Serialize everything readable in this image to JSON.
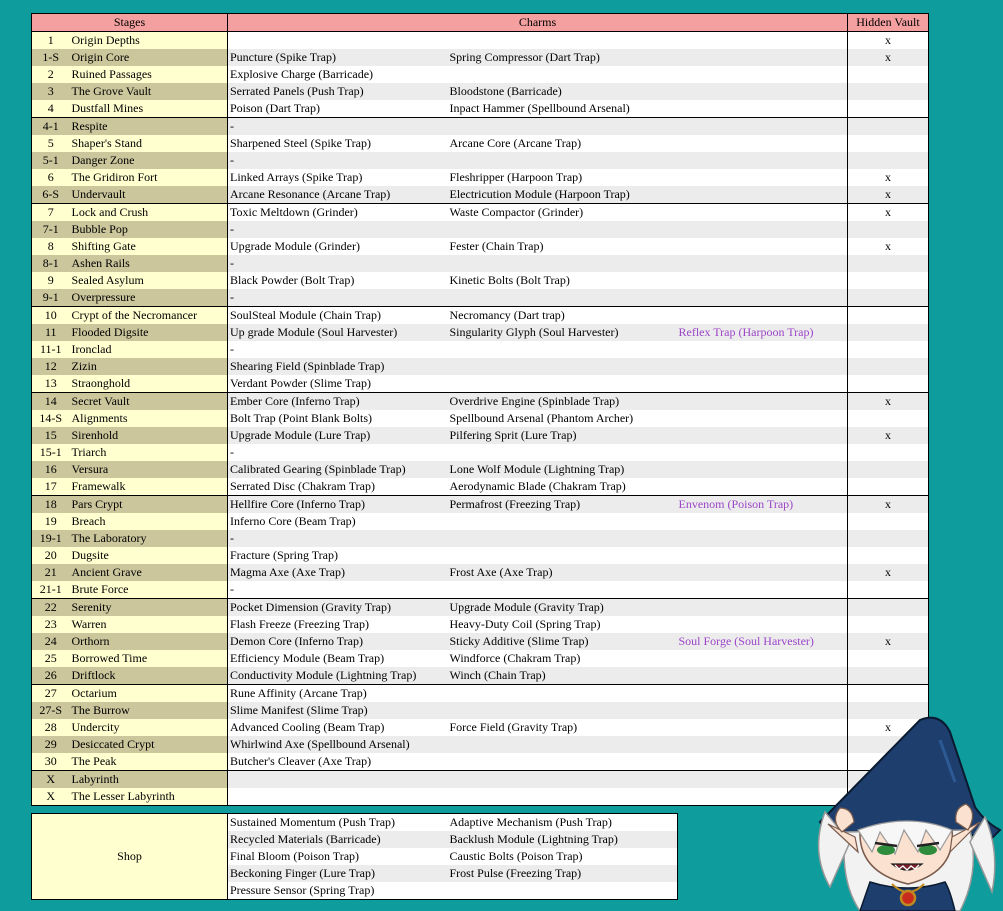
{
  "headers": {
    "stages": "Stages",
    "charms": "Charms",
    "vault": "Hidden Vault"
  },
  "rows": [
    {
      "num": "1",
      "name": "Origin Depths",
      "c1": "",
      "c2": "",
      "c3": "",
      "vault": "x"
    },
    {
      "num": "1-S",
      "name": "Origin Core",
      "c1": "Puncture (Spike Trap)",
      "c2": "Spring Compressor (Dart Trap)",
      "c3": "",
      "vault": "x"
    },
    {
      "num": "2",
      "name": "Ruined Passages",
      "c1": "Explosive Charge (Barricade)",
      "c2": "",
      "c3": "",
      "vault": ""
    },
    {
      "num": "3",
      "name": "The Grove Vault",
      "c1": "Serrated Panels (Push Trap)",
      "c2": "Bloodstone (Barricade)",
      "c3": "",
      "vault": ""
    },
    {
      "num": "4",
      "name": "Dustfall Mines",
      "c1": "Poison (Dart Trap)",
      "c2": "Inpact Hammer (Spellbound Arsenal)",
      "c3": "",
      "vault": ""
    },
    {
      "num": "4-1",
      "name": "Respite",
      "c1": "-",
      "c2": "",
      "c3": "",
      "vault": ""
    },
    {
      "num": "5",
      "name": "Shaper's Stand",
      "c1": "Sharpened Steel (Spike Trap)",
      "c2": "Arcane Core (Arcane Trap)",
      "c3": "",
      "vault": ""
    },
    {
      "num": "5-1",
      "name": "Danger Zone",
      "c1": "-",
      "c2": "",
      "c3": "",
      "vault": ""
    },
    {
      "num": "6",
      "name": "The Gridiron Fort",
      "c1": "Linked Arrays (Spike Trap)",
      "c2": "Fleshripper (Harpoon Trap)",
      "c3": "",
      "vault": "x"
    },
    {
      "num": "6-S",
      "name": "Undervault",
      "c1": "Arcane Resonance (Arcane Trap)",
      "c2": "Electricution Module (Harpoon Trap)",
      "c3": "",
      "vault": "x"
    },
    {
      "num": "7",
      "name": "Lock and Crush",
      "c1": "Toxic Meltdown (Grinder)",
      "c2": "Waste Compactor (Grinder)",
      "c3": "",
      "vault": "x"
    },
    {
      "num": "7-1",
      "name": "Bubble Pop",
      "c1": "-",
      "c2": "",
      "c3": "",
      "vault": ""
    },
    {
      "num": "8",
      "name": "Shifting Gate",
      "c1": "Upgrade Module (Grinder)",
      "c2": "Fester (Chain Trap)",
      "c3": "",
      "vault": "x"
    },
    {
      "num": "8-1",
      "name": "Ashen Rails",
      "c1": "-",
      "c2": "",
      "c3": "",
      "vault": ""
    },
    {
      "num": "9",
      "name": "Sealed Asylum",
      "c1": "Black Powder (Bolt Trap)",
      "c2": "Kinetic Bolts (Bolt Trap)",
      "c3": "",
      "vault": ""
    },
    {
      "num": "9-1",
      "name": "Overpressure",
      "c1": "-",
      "c2": "",
      "c3": "",
      "vault": ""
    },
    {
      "num": "10",
      "name": "Crypt of the Necromancer",
      "c1": "SoulSteal Module (Chain Trap)",
      "c2": "Necromancy (Dart trap)",
      "c3": "",
      "vault": ""
    },
    {
      "num": "11",
      "name": "Flooded Digsite",
      "c1": "Up grade Module (Soul Harvester)",
      "c2": "Singularity Glyph (Soul Harvester)",
      "c3": "Reflex Trap (Harpoon Trap)",
      "vault": ""
    },
    {
      "num": "11-1",
      "name": "Ironclad",
      "c1": "-",
      "c2": "",
      "c3": "",
      "vault": ""
    },
    {
      "num": "12",
      "name": "Zizin",
      "c1": "Shearing Field (Spinblade Trap)",
      "c2": "",
      "c3": "",
      "vault": ""
    },
    {
      "num": "13",
      "name": "Straonghold",
      "c1": "Verdant Powder (Slime Trap)",
      "c2": "",
      "c3": "",
      "vault": ""
    },
    {
      "num": "14",
      "name": "Secret Vault",
      "c1": "Ember Core (Inferno Trap)",
      "c2": "Overdrive Engine (Spinblade Trap)",
      "c3": "",
      "vault": "x"
    },
    {
      "num": "14-S",
      "name": "Alignments",
      "c1": "Bolt Trap (Point Blank Bolts)",
      "c2": "Spellbound Arsenal (Phantom Archer)",
      "c3": "",
      "vault": ""
    },
    {
      "num": "15",
      "name": "Sirenhold",
      "c1": "Upgrade Module (Lure Trap)",
      "c2": "Pilfering Sprit (Lure Trap)",
      "c3": "",
      "vault": "x"
    },
    {
      "num": "15-1",
      "name": "Triarch",
      "c1": "-",
      "c2": "",
      "c3": "",
      "vault": ""
    },
    {
      "num": "16",
      "name": "Versura",
      "c1": "Calibrated Gearing (Spinblade Trap)",
      "c2": "Lone Wolf Module (Lightning Trap)",
      "c3": "",
      "vault": ""
    },
    {
      "num": "17",
      "name": "Framewalk",
      "c1": "Serrated Disc (Chakram Trap)",
      "c2": "Aerodynamic Blade (Chakram Trap)",
      "c3": "",
      "vault": ""
    },
    {
      "num": "18",
      "name": "Pars Crypt",
      "c1": "Hellfire Core (Inferno Trap)",
      "c2": "Permafrost (Freezing Trap)",
      "c3": "Envenom (Poison Trap)",
      "vault": "x"
    },
    {
      "num": "19",
      "name": "Breach",
      "c1": "Inferno Core (Beam Trap)",
      "c2": "",
      "c3": "",
      "vault": ""
    },
    {
      "num": "19-1",
      "name": "The Laboratory",
      "c1": "-",
      "c2": "",
      "c3": "",
      "vault": ""
    },
    {
      "num": "20",
      "name": "Dugsite",
      "c1": "Fracture (Spring Trap)",
      "c2": "",
      "c3": "",
      "vault": ""
    },
    {
      "num": "21",
      "name": "Ancient Grave",
      "c1": "Magma Axe (Axe Trap)",
      "c2": "Frost Axe (Axe Trap)",
      "c3": "",
      "vault": "x"
    },
    {
      "num": "21-1",
      "name": "Brute Force",
      "c1": "-",
      "c2": "",
      "c3": "",
      "vault": ""
    },
    {
      "num": "22",
      "name": "Serenity",
      "c1": "Pocket Dimension (Gravity Trap)",
      "c2": "Upgrade Module (Gravity Trap)",
      "c3": "",
      "vault": ""
    },
    {
      "num": "23",
      "name": "Warren",
      "c1": "Flash Freeze (Freezing Trap)",
      "c2": "Heavy-Duty Coil (Spring Trap)",
      "c3": "",
      "vault": ""
    },
    {
      "num": "24",
      "name": "Orthorn",
      "c1": "Demon Core (Inferno Trap)",
      "c2": "Sticky Additive (Slime Trap)",
      "c3": "Soul Forge (Soul Harvester)",
      "vault": "x"
    },
    {
      "num": "25",
      "name": "Borrowed Time",
      "c1": "Efficiency Module (Beam Trap)",
      "c2": "Windforce (Chakram Trap)",
      "c3": "",
      "vault": ""
    },
    {
      "num": "26",
      "name": "Driftlock",
      "c1": "Conductivity Module (Lightning Trap)",
      "c2": "Winch (Chain Trap)",
      "c3": "",
      "vault": ""
    },
    {
      "num": "27",
      "name": "Octarium",
      "c1": "Rune Affinity (Arcane Trap)",
      "c2": "",
      "c3": "",
      "vault": ""
    },
    {
      "num": "27-S",
      "name": "The Burrow",
      "c1": "Slime Manifest (Slime Trap)",
      "c2": "",
      "c3": "",
      "vault": ""
    },
    {
      "num": "28",
      "name": "Undercity",
      "c1": "Advanced Cooling (Beam Trap)",
      "c2": "Force Field (Gravity Trap)",
      "c3": "",
      "vault": "x"
    },
    {
      "num": "29",
      "name": "Desiccated Crypt",
      "c1": "Whirlwind Axe (Spellbound Arsenal)",
      "c2": "",
      "c3": "",
      "vault": ""
    },
    {
      "num": "30",
      "name": "The Peak",
      "c1": "Butcher's Cleaver (Axe Trap)",
      "c2": "",
      "c3": "",
      "vault": ""
    },
    {
      "num": "X",
      "name": "Labyrinth",
      "c1": "",
      "c2": "",
      "c3": "",
      "vault": ""
    },
    {
      "num": "X",
      "name": "The Lesser Labyrinth",
      "c1": "",
      "c2": "",
      "c3": "",
      "vault": ""
    }
  ],
  "shop": {
    "label": "Shop",
    "rows": [
      {
        "c1": "Sustained Momentum (Push Trap)",
        "c2": "Adaptive Mechanism (Push Trap)"
      },
      {
        "c1": "Recycled Materials (Barricade)",
        "c2": "Backlush Module (Lightning Trap)"
      },
      {
        "c1": "Final Bloom (Poison Trap)",
        "c2": "Caustic Bolts (Poison Trap)"
      },
      {
        "c1": "Beckoning Finger (Lure Trap)",
        "c2": "Frost Pulse (Freezing Trap)"
      },
      {
        "c1": "Pressure Sensor (Spring Trap)",
        "c2": ""
      }
    ]
  },
  "colors": {
    "background": "#0f9c9c",
    "header": "#f4a0a0",
    "stage_light": "#ffffd0",
    "stage_dark": "#cbc69c",
    "third_charm": "#9b45c8"
  },
  "mascot_icon": "witch-girl-mascot-icon"
}
